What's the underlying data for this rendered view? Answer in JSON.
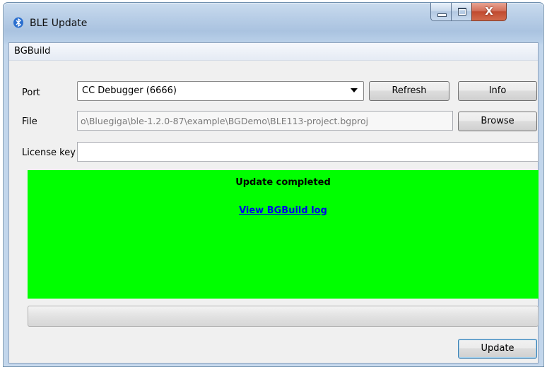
{
  "window": {
    "title": "BLE Update",
    "close_glyph": "X"
  },
  "menu": {
    "items": [
      "BGBuild"
    ]
  },
  "form": {
    "port": {
      "label": "Port",
      "selected": "CC Debugger (6666)",
      "refresh_label": "Refresh",
      "info_label": "Info"
    },
    "file": {
      "label": "File",
      "value": "o\\Bluegiga\\ble-1.2.0-87\\example\\BGDemo\\BLE113-project.bgproj",
      "browse_label": "Browse"
    },
    "license": {
      "label": "License key",
      "value": ""
    }
  },
  "status": {
    "title": "Update completed",
    "link": "View BGBuild log",
    "background_color": "#00ff00"
  },
  "progress": {
    "fraction": 0
  },
  "actions": {
    "update_label": "Update"
  },
  "icons": {
    "app": "bluetooth-icon",
    "minimize": "minimize-icon",
    "maximize": "maximize-icon",
    "close": "close-icon",
    "dropdown": "chevron-down-icon"
  }
}
